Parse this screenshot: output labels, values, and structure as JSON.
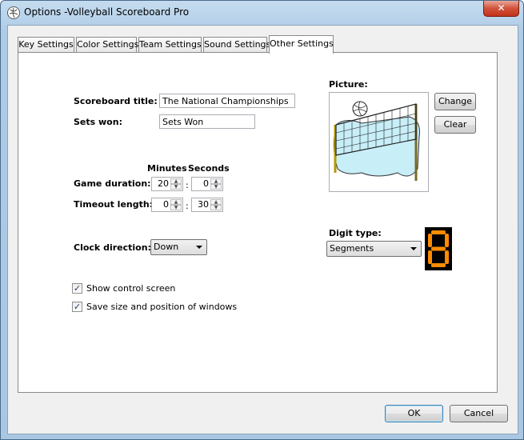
{
  "window": {
    "title": "Options -Volleyball Scoreboard Pro",
    "close_glyph": "✕"
  },
  "tabs": [
    {
      "label": "Key Settings",
      "active": false
    },
    {
      "label": "Color Settings",
      "active": false
    },
    {
      "label": "Team Settings",
      "active": false
    },
    {
      "label": "Sound Settings",
      "active": false
    },
    {
      "label": "Other Settings",
      "active": true
    }
  ],
  "form": {
    "scoreboard_title_label": "Scoreboard title:",
    "scoreboard_title_value": "The National Championships",
    "sets_won_label": "Sets won:",
    "sets_won_value": "Sets Won",
    "minutes_header": "Minutes",
    "seconds_header": "Seconds",
    "game_duration_label": "Game duration:",
    "game_duration_minutes": "20",
    "game_duration_seconds": "0",
    "timeout_length_label": "Timeout length:",
    "timeout_length_minutes": "0",
    "timeout_length_seconds": "30",
    "separator": ":",
    "clock_direction_label": "Clock direction:",
    "clock_direction_value": "Down",
    "show_control_screen_label": "Show control screen",
    "show_control_screen_checked": true,
    "save_size_label": "Save size and position of windows",
    "save_size_checked": true,
    "check_glyph": "✓"
  },
  "picture": {
    "label": "Picture:",
    "change_button": "Change",
    "clear_button": "Clear",
    "image_icon": "volleyball-net-icon"
  },
  "digit": {
    "label": "Digit type:",
    "value": "Segments",
    "preview_digit": "8",
    "color": "#ff8c00",
    "background": "#000000"
  },
  "footer": {
    "ok_button": "OK",
    "cancel_button": "Cancel"
  },
  "colors": {
    "title_bar": "#aecbe6",
    "dialog": "#f0f0f0",
    "close_red": "#c2331b"
  }
}
